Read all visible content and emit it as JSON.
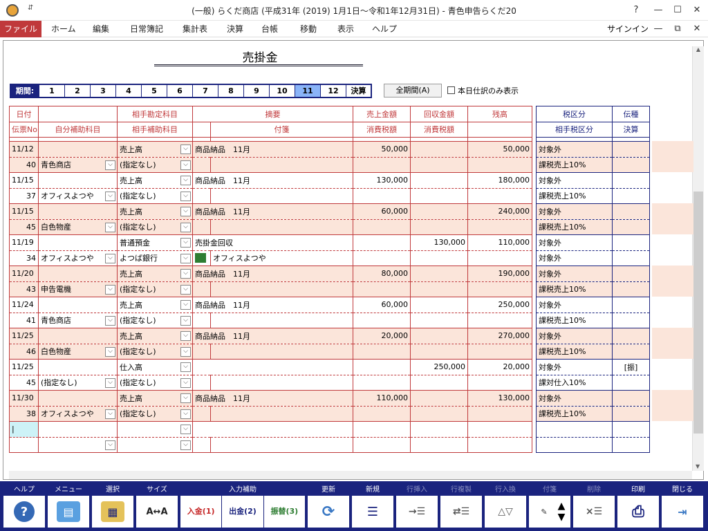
{
  "window": {
    "title": "(一般) らくだ商店 (平成31年 (2019) 1月1日～令和1年12月31日) - 青色申告らくだ20",
    "quick_access": "⇵",
    "help": "?",
    "signin": "サインイン"
  },
  "menu": [
    "ファイル",
    "ホーム",
    "編集",
    "日常簿記",
    "集計表",
    "決算",
    "台帳",
    "移動",
    "表示",
    "ヘルプ"
  ],
  "page_title": "売掛金",
  "period": {
    "label": "期間:",
    "items": [
      "1",
      "2",
      "3",
      "4",
      "5",
      "6",
      "7",
      "8",
      "9",
      "10",
      "11",
      "12",
      "決算"
    ],
    "selected": "11"
  },
  "all_period_button": "全期間(A)",
  "today_only_label": "本日仕訳のみ表示",
  "headers": {
    "row1": [
      "日付",
      "",
      "相手勘定科目",
      "摘要",
      "売上金額",
      "回収金額",
      "残高"
    ],
    "row2": [
      "伝票No",
      "自分補助科目",
      "相手補助科目",
      "付箋",
      "消費税額",
      "消費税額",
      ""
    ],
    "side1": [
      "税区分",
      "伝種"
    ],
    "side2": [
      "相手税区分",
      "決算"
    ]
  },
  "entries": [
    {
      "date": "11/12",
      "no": "40",
      "sub": "青色商店",
      "acct": "売上高",
      "acct_sub": "(指定なし)",
      "memo": "商品納品　11月",
      "note": "",
      "sales": "50,000",
      "collect": "",
      "balance": "50,000",
      "tax": "対象外",
      "tax2": "課税売上10%",
      "type": "",
      "pink": true
    },
    {
      "date": "11/15",
      "no": "37",
      "sub": "オフィスよつや",
      "acct": "売上高",
      "acct_sub": "(指定なし)",
      "memo": "商品納品　11月",
      "note": "",
      "sales": "130,000",
      "collect": "",
      "balance": "180,000",
      "tax": "対象外",
      "tax2": "課税売上10%",
      "type": "",
      "pink": false
    },
    {
      "date": "11/15",
      "no": "45",
      "sub": "白色物産",
      "acct": "売上高",
      "acct_sub": "(指定なし)",
      "memo": "商品納品　11月",
      "note": "",
      "sales": "60,000",
      "collect": "",
      "balance": "240,000",
      "tax": "対象外",
      "tax2": "課税売上10%",
      "type": "",
      "pink": true
    },
    {
      "date": "11/19",
      "no": "34",
      "sub": "オフィスよつや",
      "acct": "普通預金",
      "acct_sub": "よつば銀行",
      "memo": "売掛金回収",
      "note": "オフィスよつや",
      "sales": "",
      "collect": "130,000",
      "balance": "110,000",
      "tax": "対象外",
      "tax2": "対象外",
      "type": "",
      "pink": false,
      "green": true
    },
    {
      "date": "11/20",
      "no": "43",
      "sub": "申告電機",
      "acct": "売上高",
      "acct_sub": "(指定なし)",
      "memo": "商品納品　11月",
      "note": "",
      "sales": "80,000",
      "collect": "",
      "balance": "190,000",
      "tax": "対象外",
      "tax2": "課税売上10%",
      "type": "",
      "pink": true
    },
    {
      "date": "11/24",
      "no": "41",
      "sub": "青色商店",
      "acct": "売上高",
      "acct_sub": "(指定なし)",
      "memo": "商品納品　11月",
      "note": "",
      "sales": "60,000",
      "collect": "",
      "balance": "250,000",
      "tax": "対象外",
      "tax2": "課税売上10%",
      "type": "",
      "pink": false
    },
    {
      "date": "11/25",
      "no": "46",
      "sub": "白色物産",
      "acct": "売上高",
      "acct_sub": "(指定なし)",
      "memo": "商品納品　11月",
      "note": "",
      "sales": "20,000",
      "collect": "",
      "balance": "270,000",
      "tax": "対象外",
      "tax2": "課税売上10%",
      "type": "",
      "pink": true
    },
    {
      "date": "11/25",
      "no": "45",
      "sub": "(指定なし)",
      "acct": "仕入高",
      "acct_sub": "(指定なし)",
      "memo": "",
      "note": "",
      "sales": "",
      "collect": "250,000",
      "balance": "20,000",
      "tax": "対象外",
      "tax2": "課対仕入10%",
      "type": "[振]",
      "pink": false
    },
    {
      "date": "11/30",
      "no": "38",
      "sub": "オフィスよつや",
      "acct": "売上高",
      "acct_sub": "(指定なし)",
      "memo": "商品納品　11月",
      "note": "",
      "sales": "110,000",
      "collect": "",
      "balance": "130,000",
      "tax": "対象外",
      "tax2": "課税売上10%",
      "type": "",
      "pink": true
    }
  ],
  "toolbar": [
    {
      "label": "ヘルプ",
      "icon": "help-icon",
      "glyph": "?"
    },
    {
      "label": "メニュー",
      "icon": "menu-icon",
      "glyph": "▤"
    },
    {
      "label": "選択",
      "icon": "select-icon",
      "glyph": "▦"
    },
    {
      "label": "サイズ",
      "icon": "font-size-icon",
      "glyph": "A↔A"
    },
    {
      "label": "入力補助",
      "icon": "input-assist-icon",
      "sub": [
        "入金(1)",
        "出金(2)",
        "振替(3)"
      ]
    },
    {
      "label": "更新",
      "icon": "refresh-icon",
      "glyph": "⟳"
    },
    {
      "label": "新規",
      "icon": "new-icon",
      "glyph": "☰"
    },
    {
      "label": "行挿入",
      "icon": "insert-row-icon",
      "glyph": "→☰"
    },
    {
      "label": "行複製",
      "icon": "duplicate-row-icon",
      "glyph": "⇄☰"
    },
    {
      "label": "行入換",
      "icon": "swap-row-icon",
      "glyph": "△▽"
    },
    {
      "label": "付箋",
      "icon": "sticky-note-icon",
      "glyph": "✎"
    },
    {
      "label": "削除",
      "icon": "delete-icon",
      "glyph": "×☰"
    },
    {
      "label": "印刷",
      "icon": "print-icon",
      "glyph": "⎙"
    },
    {
      "label": "閉じる",
      "icon": "close-icon",
      "glyph": "⇥"
    }
  ],
  "colors": {
    "accent_red": "#c0393b",
    "navy": "#1a237e",
    "row_pink": "#fbe5da",
    "selected_period": "#8ab4f8"
  }
}
